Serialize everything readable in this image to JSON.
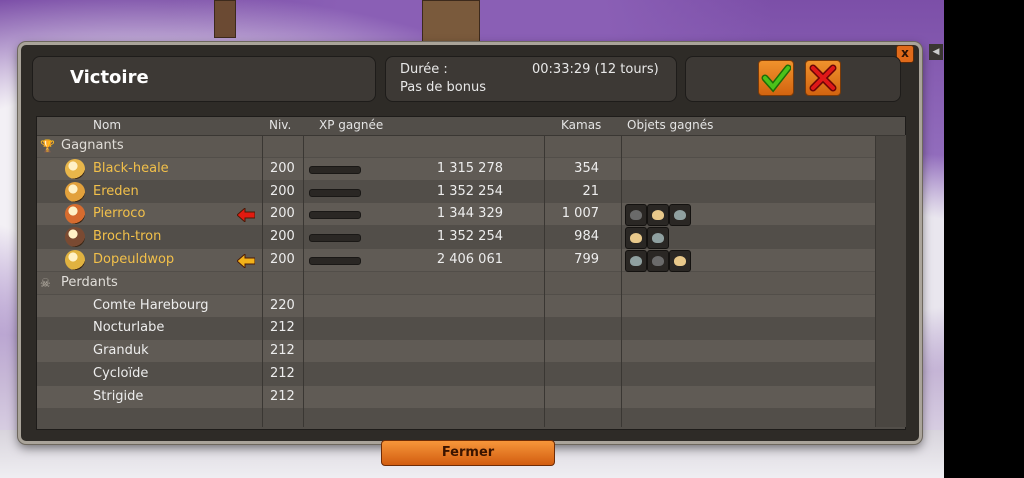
{
  "window": {
    "title": "Victoire",
    "duration_label": "Durée :",
    "duration_value": "00:33:29 (12 tours)",
    "bonus_text": "Pas de bonus",
    "close_glyph": "x",
    "side_tab_glyph": "◀"
  },
  "columns": {
    "name": "Nom",
    "level": "Niv.",
    "xp": "XP gagnée",
    "kamas": "Kamas",
    "items": "Objets gagnés"
  },
  "winners": {
    "label": "Gagnants",
    "icon": "trophy-icon",
    "rows": [
      {
        "name": "Black-heale",
        "level": "200",
        "xp": "1 315 278",
        "kamas": "354",
        "arrow": "",
        "items": []
      },
      {
        "name": "Ereden",
        "level": "200",
        "xp": "1 352 254",
        "kamas": "21",
        "arrow": "",
        "items": []
      },
      {
        "name": "Pierroco",
        "level": "200",
        "xp": "1 344 329",
        "kamas": "1 007",
        "arrow": "red",
        "items": [
          "loot-item-icon",
          "loot-item-icon",
          "loot-item-icon"
        ]
      },
      {
        "name": "Broch-tron",
        "level": "200",
        "xp": "1 352 254",
        "kamas": "984",
        "arrow": "",
        "items": [
          "loot-item-icon",
          "loot-item-icon"
        ]
      },
      {
        "name": "Dopeuldwop",
        "level": "200",
        "xp": "2 406 061",
        "kamas": "799",
        "arrow": "yellow",
        "items": [
          "loot-item-icon",
          "loot-item-icon",
          "loot-item-icon"
        ]
      }
    ]
  },
  "losers": {
    "label": "Perdants",
    "icon": "skull-icon",
    "rows": [
      {
        "name": "Comte Harebourg",
        "level": "220"
      },
      {
        "name": "Nocturlabe",
        "level": "212"
      },
      {
        "name": "Granduk",
        "level": "212"
      },
      {
        "name": "Cycloïde",
        "level": "212"
      },
      {
        "name": "Strigide",
        "level": "212"
      }
    ]
  },
  "buttons": {
    "close_label": "Fermer"
  },
  "colors": {
    "winner_name": "#f2c04a",
    "accent_orange": "#e06a1a",
    "check_green": "#4bc21a",
    "cross_red": "#e01818"
  }
}
